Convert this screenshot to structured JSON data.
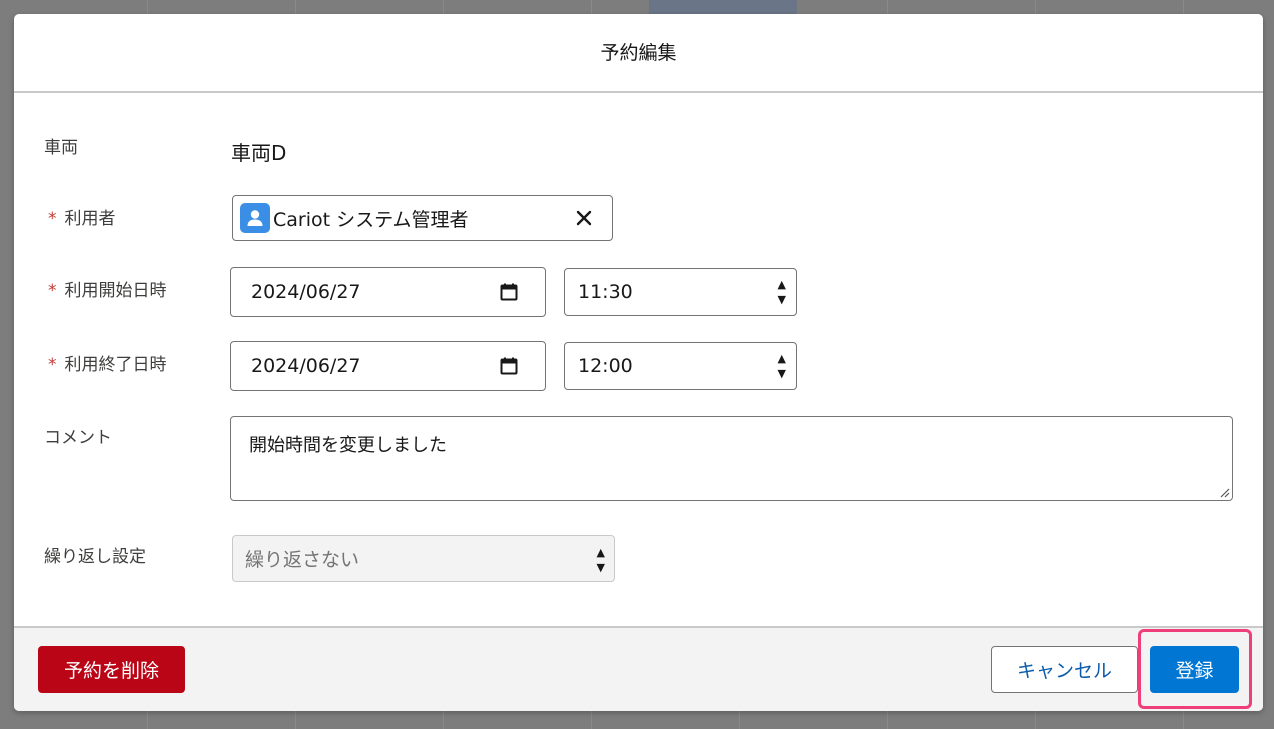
{
  "modal": {
    "title": "予約編集"
  },
  "form": {
    "vehicle": {
      "label": "車両",
      "value": "車両D"
    },
    "user": {
      "required_mark": "*",
      "label": "利用者",
      "value": "Cariot システム管理者",
      "clear_icon": "close-icon"
    },
    "start": {
      "required_mark": "*",
      "label": "利用開始日時",
      "date": "2024/06/27",
      "time": "11:30"
    },
    "end": {
      "required_mark": "*",
      "label": "利用終了日時",
      "date": "2024/06/27",
      "time": "12:00"
    },
    "comment": {
      "label": "コメント",
      "value": "開始時間を変更しました"
    },
    "repeat": {
      "label": "繰り返し設定",
      "value": "繰り返さない",
      "disabled": true
    }
  },
  "footer": {
    "delete_label": "予約を削除",
    "cancel_label": "キャンセル",
    "save_label": "登録"
  },
  "colors": {
    "delete": "#ba0517",
    "primary": "#0176d3",
    "link": "#0b5cab",
    "required": "#c23934",
    "highlight": "#ef3f7a",
    "avatar": "#3b8ee5"
  }
}
